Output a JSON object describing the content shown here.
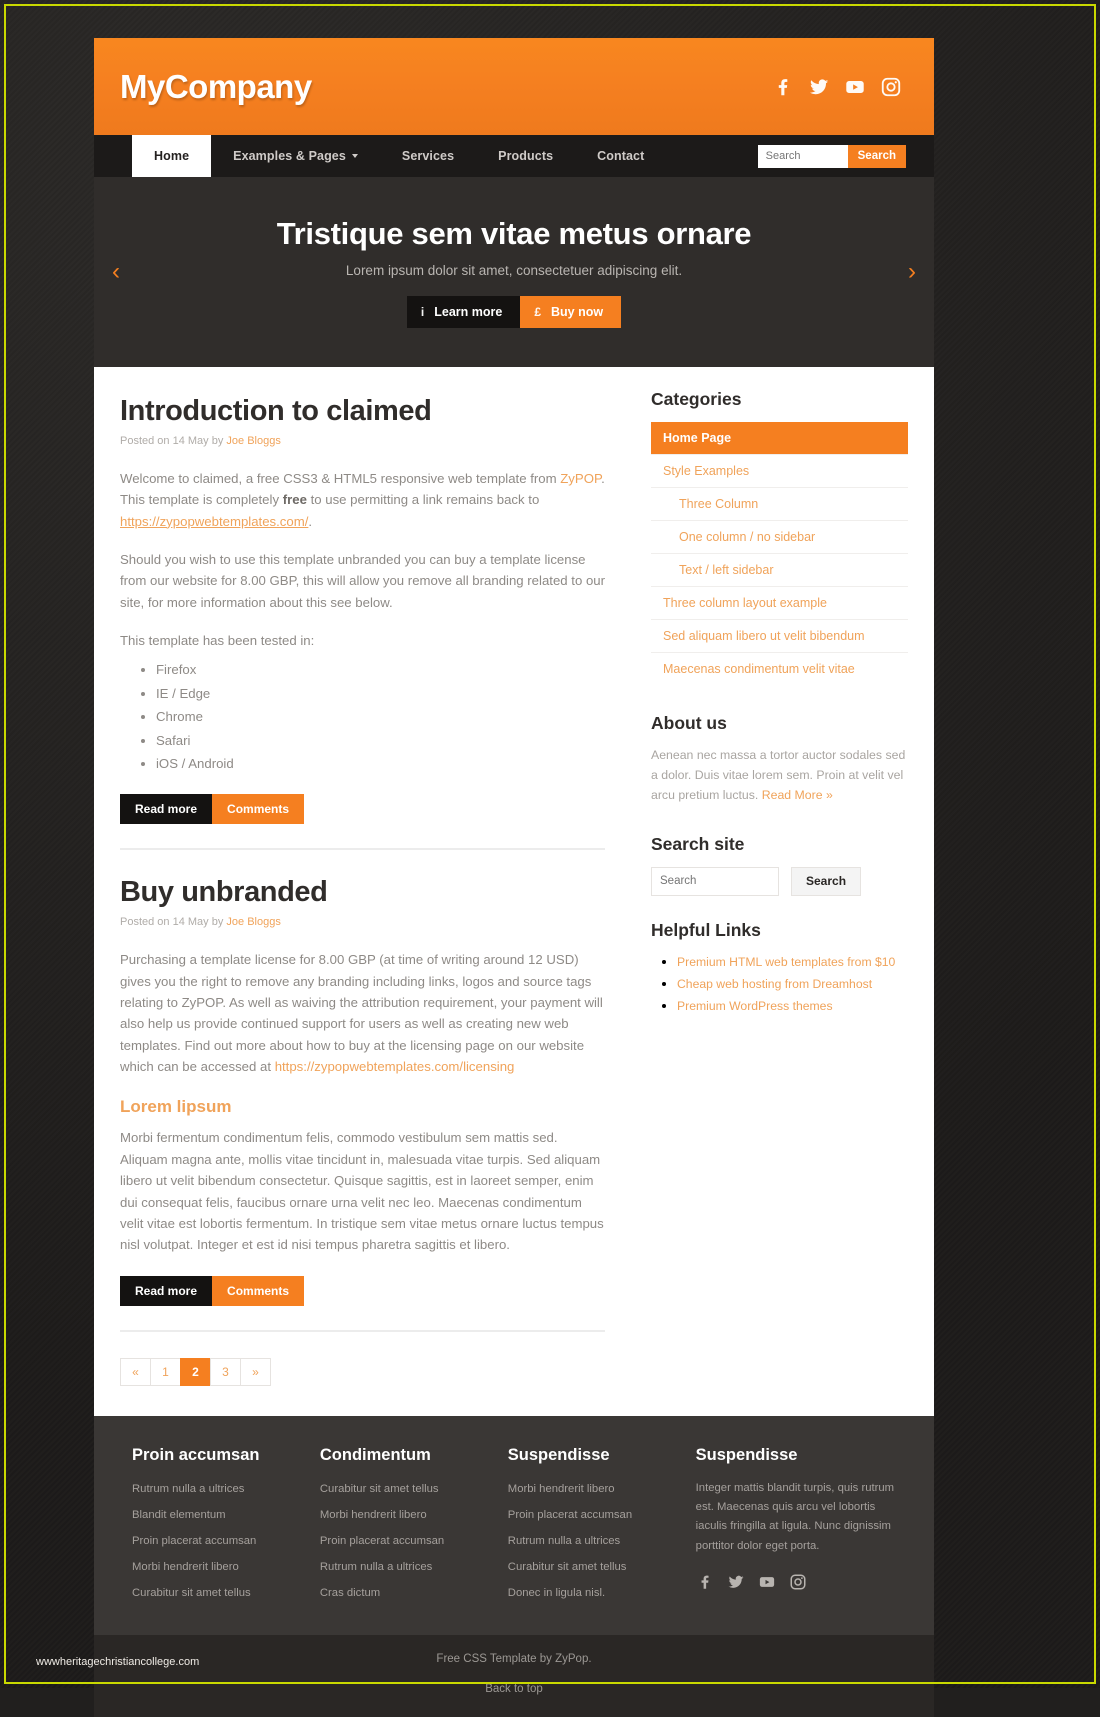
{
  "header": {
    "brand": "MyCompany",
    "socials": [
      {
        "name": "facebook-icon",
        "label": "Facebook"
      },
      {
        "name": "twitter-icon",
        "label": "Twitter"
      },
      {
        "name": "youtube-icon",
        "label": "YouTube"
      },
      {
        "name": "instagram-icon",
        "label": "Instagram"
      }
    ]
  },
  "nav": {
    "items": [
      {
        "label": "Home",
        "active": true,
        "caret": false
      },
      {
        "label": "Examples & Pages",
        "active": false,
        "caret": true
      },
      {
        "label": "Services",
        "active": false,
        "caret": false
      },
      {
        "label": "Products",
        "active": false,
        "caret": false
      },
      {
        "label": "Contact",
        "active": false,
        "caret": false
      }
    ],
    "search_placeholder": "Search",
    "search_value": "",
    "search_button": "Search"
  },
  "hero": {
    "title": "Tristique sem vitae metus ornare",
    "subtitle": "Lorem ipsum dolor sit amet, consectetuer adipiscing elit.",
    "learn_more": "Learn more",
    "learn_more_icon": "i",
    "buy_now": "Buy now",
    "buy_now_icon": "£",
    "prev_arrow": "‹",
    "next_arrow": "›"
  },
  "posts": [
    {
      "title": "Introduction to claimed",
      "meta_prefix": "Posted on 14 May by ",
      "meta_author": "Joe Bloggs",
      "p1_a": "Welcome to claimed, a free CSS3 & HTML5 responsive web template from ",
      "p1_link1": "ZyPOP",
      "p1_b": ". This template is completely ",
      "p1_bold": "free",
      "p1_c": " to use permitting a link remains back to ",
      "p1_link2": "https://zypopwebtemplates.com/",
      "p1_d": ".",
      "p2": "Should you wish to use this template unbranded you can buy a template license from our website for 8.00 GBP, this will allow you remove all branding related to our site, for more information about this see below.",
      "p3": "This template has been tested in:",
      "browsers": [
        "Firefox",
        "IE / Edge",
        "Chrome",
        "Safari",
        "iOS / Android"
      ],
      "read_more": "Read more",
      "comments": "Comments"
    },
    {
      "title": "Buy unbranded",
      "meta_prefix": "Posted on 14 May by ",
      "meta_author": "Joe Bloggs",
      "p1_a": "Purchasing a template license for 8.00 GBP (at time of writing around 12 USD) gives you the right to remove any branding including links, logos and source tags relating to ZyPOP. As well as waiving the attribution requirement, your payment will also help us provide continued support for users as well as creating new web templates. Find out more about how to buy at the licensing page on our website which can be accessed at ",
      "p1_link": "https://zypopwebtemplates.com/licensing",
      "subheading": "Lorem lipsum",
      "p2": "Morbi fermentum condimentum felis, commodo vestibulum sem mattis sed. Aliquam magna ante, mollis vitae tincidunt in, malesuada vitae turpis. Sed aliquam libero ut velit bibendum consectetur. Quisque sagittis, est in laoreet semper, enim dui consequat felis, faucibus ornare urna velit nec leo. Maecenas condimentum velit vitae est lobortis fermentum. In tristique sem vitae metus ornare luctus tempus nisl volutpat. Integer et est id nisi tempus pharetra sagittis et libero.",
      "read_more": "Read more",
      "comments": "Comments"
    }
  ],
  "pagination": {
    "items": [
      {
        "label": "«",
        "active": false
      },
      {
        "label": "1",
        "active": false
      },
      {
        "label": "2",
        "active": true
      },
      {
        "label": "3",
        "active": false
      },
      {
        "label": "»",
        "active": false
      }
    ]
  },
  "sidebar": {
    "categories_title": "Categories",
    "categories": [
      {
        "label": "Home Page",
        "active": true,
        "indent": false
      },
      {
        "label": "Style Examples",
        "active": false,
        "indent": false
      },
      {
        "label": "Three Column",
        "active": false,
        "indent": true
      },
      {
        "label": "One column / no sidebar",
        "active": false,
        "indent": true
      },
      {
        "label": "Text / left sidebar",
        "active": false,
        "indent": true
      },
      {
        "label": "Three column layout example",
        "active": false,
        "indent": false
      },
      {
        "label": "Sed aliquam libero ut velit bibendum",
        "active": false,
        "indent": false
      },
      {
        "label": "Maecenas condimentum velit vitae",
        "active": false,
        "indent": false
      }
    ],
    "about_title": "About us",
    "about_text": "Aenean nec massa a tortor auctor sodales sed a dolor. Duis vitae lorem sem. Proin at velit vel arcu pretium luctus. ",
    "about_link": "Read More »",
    "search_title": "Search site",
    "search_placeholder": "Search",
    "search_value": "",
    "search_button": "Search",
    "helpful_title": "Helpful Links",
    "helpful_links": [
      "Premium HTML web templates from $10",
      "Cheap web hosting from Dreamhost",
      "Premium WordPress themes"
    ]
  },
  "footer": {
    "columns": [
      {
        "title": "Proin accumsan",
        "links": [
          "Rutrum nulla a ultrices",
          "Blandit elementum",
          "Proin placerat accumsan",
          "Morbi hendrerit libero",
          "Curabitur sit amet tellus"
        ]
      },
      {
        "title": "Condimentum",
        "links": [
          "Curabitur sit amet tellus",
          "Morbi hendrerit libero",
          "Proin placerat accumsan",
          "Rutrum nulla a ultrices",
          "Cras dictum"
        ]
      },
      {
        "title": "Suspendisse",
        "links": [
          "Morbi hendrerit libero",
          "Proin placerat accumsan",
          "Rutrum nulla a ultrices",
          "Curabitur sit amet tellus",
          "Donec in ligula nisl."
        ]
      }
    ],
    "last_column": {
      "title": "Suspendisse",
      "text": "Integer mattis blandit turpis, quis rutrum est. Maecenas quis arcu vel lobortis iaculis fringilla at ligula. Nunc dignissim porttitor dolor eget porta.",
      "socials": [
        {
          "name": "facebook-icon",
          "label": "Facebook"
        },
        {
          "name": "twitter-icon",
          "label": "Twitter"
        },
        {
          "name": "youtube-icon",
          "label": "YouTube"
        },
        {
          "name": "instagram-icon",
          "label": "Instagram"
        }
      ]
    },
    "credit_prefix": "Free CSS Template by ",
    "credit_link": "ZyPop",
    "credit_suffix": ".",
    "back_to_top": "Back to top"
  },
  "watermark": "wwwheritagechristiancollege.com"
}
